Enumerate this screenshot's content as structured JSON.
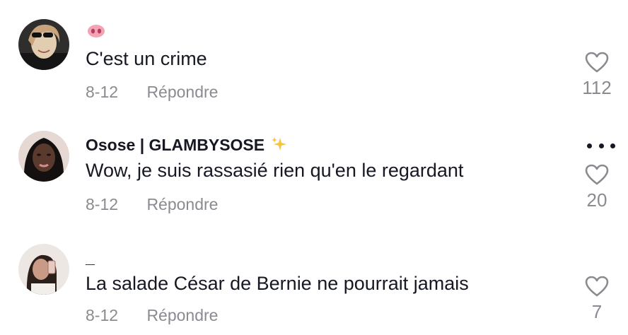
{
  "comments": [
    {
      "author": "",
      "author_emoji": "pig-nose-emoji",
      "text": "C'est un crime",
      "date": "8-12",
      "reply_label": "Répondre",
      "likes": "112",
      "avatar_colors": [
        "#3b3a38",
        "#c9a37b",
        "#e3cdb1"
      ]
    },
    {
      "author": "Osose | GLAMBYSOSE",
      "author_emoji": "sparkles-emoji",
      "text": "Wow, je suis rassasié rien qu'en le regardant",
      "date": "8-12",
      "reply_label": "Répondre",
      "likes": "20",
      "avatar_colors": [
        "#141010",
        "#5a3a2c",
        "#d98a8a"
      ]
    },
    {
      "author": "_",
      "author_emoji": "",
      "text": "La salade César de Bernie ne pourrait jamais",
      "date": "8-12",
      "reply_label": "Répondre",
      "likes": "7",
      "avatar_colors": [
        "#ece7e2",
        "#2b1f1a",
        "#c99b86"
      ]
    }
  ],
  "icons": {
    "like": "heart-outline-icon",
    "more": "more-options-icon"
  },
  "colors": {
    "text": "#161823",
    "secondary": "#8a8b91"
  }
}
